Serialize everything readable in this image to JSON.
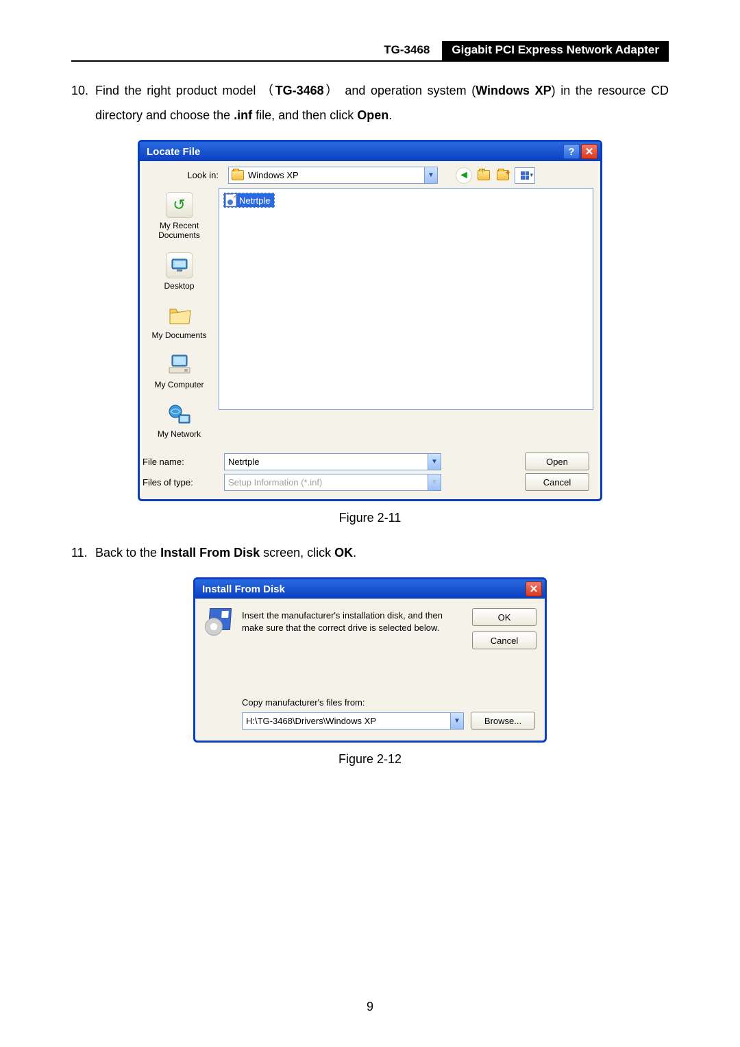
{
  "header": {
    "model": "TG-3468",
    "title": "Gigabit PCI Express Network Adapter"
  },
  "steps": {
    "s10": {
      "num": "10.",
      "t1": "Find the right product model （",
      "bold1": "TG-3468",
      "t2": "） and operation system (",
      "bold2": "Windows XP",
      "t3": ") in the resource CD directory and choose the ",
      "bold3": ".inf",
      "t4": " file, and then click ",
      "bold4": "Open",
      "t5": "."
    },
    "s11": {
      "num": "11.",
      "t1": "Back to the ",
      "bold1": "Install From Disk",
      "t2": " screen, click ",
      "bold2": "OK",
      "t3": "."
    }
  },
  "captions": {
    "fig211": "Figure 2-11",
    "fig212": "Figure 2-12"
  },
  "locate": {
    "title": "Locate File",
    "look_in_label": "Look in:",
    "look_in_value": "Windows XP",
    "selected_file": "Netrtple",
    "places": {
      "recent": "My Recent Documents",
      "desktop": "Desktop",
      "docs": "My Documents",
      "computer": "My Computer",
      "network": "My Network"
    },
    "file_name_label": "File name:",
    "file_name_value": "Netrtple",
    "file_type_label": "Files of type:",
    "file_type_value": "Setup Information (*.inf)",
    "open_btn": "Open",
    "cancel_btn": "Cancel"
  },
  "install": {
    "title": "Install From Disk",
    "text": "Insert the manufacturer's installation disk, and then make sure that the correct drive is selected below.",
    "ok_btn": "OK",
    "cancel_btn": "Cancel",
    "copy_label": "Copy manufacturer's files from:",
    "path": "H:\\TG-3468\\Drivers\\Windows XP",
    "browse_btn": "Browse..."
  },
  "page_number": "9"
}
